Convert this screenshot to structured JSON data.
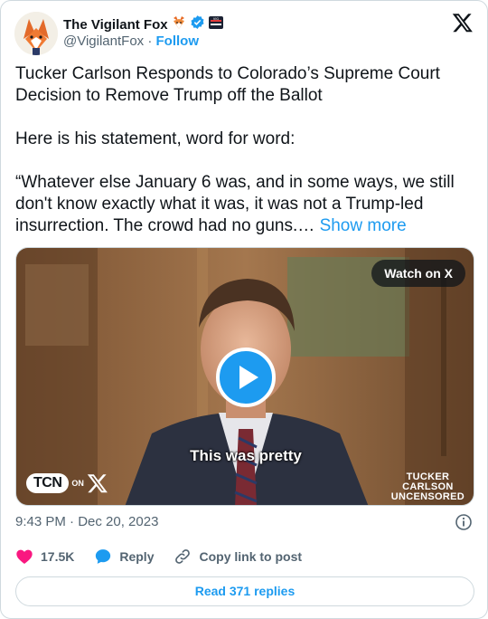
{
  "author": {
    "name": "The Vigilant Fox",
    "handle": "@VigilantFox",
    "separator": "·",
    "follow_label": "Follow"
  },
  "tweet": {
    "paragraphs": [
      "Tucker Carlson Responds to Colorado’s Supreme Court Decision to Remove Trump off the Ballot",
      "Here is his statement, word for word:",
      "“Whatever else January 6 was, and in some ways, we still don't know exactly what it was, it was not a Trump-led insurrection. The crowd had no guns.…"
    ],
    "show_more_label": "Show more"
  },
  "media": {
    "watch_label": "Watch on X",
    "caption": "This was pretty",
    "tcn_label": "TCN",
    "tcn_on": "ON",
    "brand_lines": [
      "TUCKER",
      "CARLSON",
      "UNCENSORED"
    ]
  },
  "meta": {
    "timestamp": "9:43 PM · Dec 20, 2023"
  },
  "actions": {
    "likes": "17.5K",
    "reply_label": "Reply",
    "copy_label": "Copy link to post"
  },
  "read_replies_label": "Read 371 replies",
  "colors": {
    "accent": "#1d9bf0",
    "like": "#f91880",
    "text": "#0f1419",
    "muted": "#536471",
    "border": "#cfd9de"
  },
  "icons": [
    "fox-emoji-icon",
    "verified-badge-icon",
    "affiliate-badge-icon",
    "x-logo-icon",
    "play-icon",
    "info-icon",
    "heart-icon",
    "reply-bubble-icon",
    "link-icon"
  ]
}
